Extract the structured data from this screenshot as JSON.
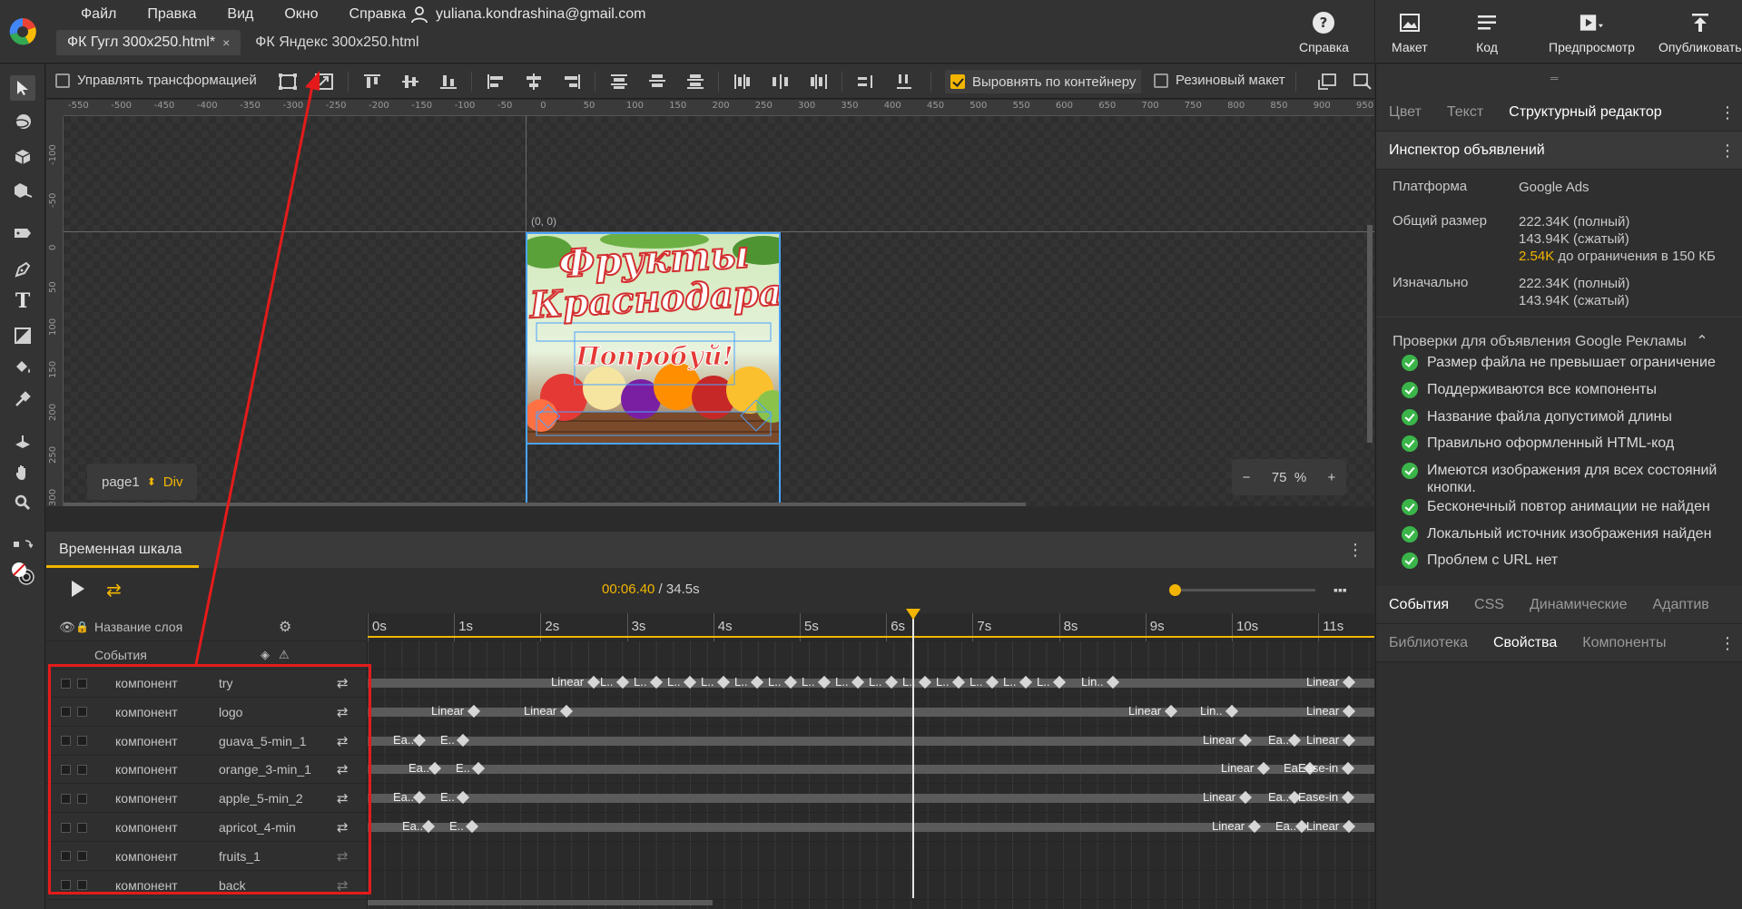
{
  "menu": [
    "Файл",
    "Правка",
    "Вид",
    "Окно",
    "Справка"
  ],
  "account_email": "yuliana.kondrashina@gmail.com",
  "doc_tabs": [
    {
      "label": "ФК Гугл 300x250.html*",
      "close": "×"
    },
    {
      "label": "ФК Яндекс 300x250.html"
    }
  ],
  "top_actions": {
    "help": "Справка",
    "layout": "Макет",
    "code": "Код",
    "preview": "Предпросмотр",
    "publish": "Опубликовать"
  },
  "toolbar": {
    "manage_transform": "Управлять трансформацией",
    "align_container": "Выровнять по контейнеру",
    "rubber_layout": "Резиновый макет"
  },
  "ruler_top_labels": [
    "-550",
    "-500",
    "-450",
    "-400",
    "-350",
    "-300",
    "-250",
    "-200",
    "-150",
    "-100",
    "-50",
    "0",
    "50",
    "100",
    "150",
    "200",
    "250",
    "300",
    "350",
    "400",
    "450",
    "500",
    "550",
    "600",
    "650",
    "700",
    "750",
    "800",
    "850",
    "900",
    "950"
  ],
  "ruler_left_labels": [
    "-100",
    "-50",
    "0",
    "50",
    "100",
    "150",
    "200",
    "250",
    "300"
  ],
  "stage": {
    "origin": "(0, 0)",
    "page": "page1",
    "page_type": "Div",
    "zoom_minus": "−",
    "zoom_value": "75",
    "zoom_unit": "%",
    "zoom_plus": "+"
  },
  "timeline": {
    "title": "Временная шкала",
    "kebab": "⋮",
    "current_time": "00:06.40",
    "total_time": "34.5s",
    "layer_name_header": "Название слоя",
    "events_label": "События",
    "time_marks": [
      "0s",
      "1s",
      "2s",
      "3s",
      "4s",
      "5s",
      "6s",
      "7s",
      "8s",
      "9s",
      "10s",
      "11s"
    ],
    "layers": [
      {
        "type": "компонент",
        "name": "try",
        "loop": true
      },
      {
        "type": "компонент",
        "name": "logo",
        "loop": true
      },
      {
        "type": "компонент",
        "name": "guava_5-min_1",
        "loop": true
      },
      {
        "type": "компонент",
        "name": "orange_3-min_1",
        "loop": true
      },
      {
        "type": "компонент",
        "name": "apple_5-min_2",
        "loop": true
      },
      {
        "type": "компонент",
        "name": "apricot_4-min",
        "loop": true
      },
      {
        "type": "компонент",
        "name": "fruits_1",
        "loop": false
      },
      {
        "type": "компонент",
        "name": "back",
        "loop": false
      }
    ],
    "keyframe_labels": {
      "linear": "Linear",
      "l": "L..",
      "lin": "Lin..",
      "ea": "Ea..",
      "e": "E..",
      "easein": "Ease-in"
    }
  },
  "rpanel": {
    "tabs_top": [
      "Цвет",
      "Текст",
      "Структурный редактор"
    ],
    "inspector_title": "Инспектор объявлений",
    "platform_label": "Платформа",
    "platform_value": "Google Ads",
    "size_label": "Общий размер",
    "size_full": "222.34K (полный)",
    "size_zip": "143.94K (сжатый)",
    "size_remaining": "2.54K",
    "size_remaining_suffix": "до ограничения в 150 КБ",
    "initial_label": "Изначально",
    "initial_full": "222.34K (полный)",
    "initial_zip": "143.94K (сжатый)",
    "checks_title": "Проверки для объявления Google Рекламы",
    "checks": [
      "Размер файла не превышает ограничение",
      "Поддерживаются все компоненты",
      "Название файла допустимой длины",
      "Правильно оформленный HTML-код",
      "Имеются изображения для всех состояний кнопки.",
      "Бесконечный повтор анимации не найден",
      "Локальный источник изображения найден",
      "Проблем с URL нет"
    ],
    "tabs_mid": [
      "События",
      "CSS",
      "Динамические",
      "Адаптив"
    ],
    "tabs_bottom": [
      "Библиотека",
      "Свойства",
      "Компоненты"
    ]
  },
  "banner": {
    "title_line1": "Фрукты",
    "title_line2": "Краснодара",
    "cta": "Попробуй!"
  }
}
